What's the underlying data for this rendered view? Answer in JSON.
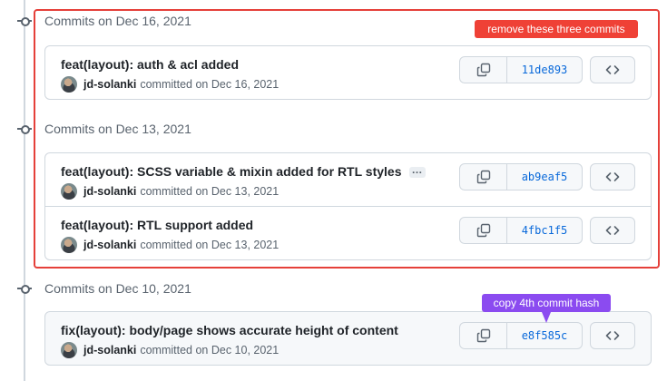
{
  "groups": [
    {
      "title": "Commits on Dec 16, 2021",
      "commits": [
        {
          "message": "feat(layout): auth & acl added",
          "author": "jd-solanki",
          "committed": "committed on Dec 16, 2021",
          "sha": "11de893"
        }
      ]
    },
    {
      "title": "Commits on Dec 13, 2021",
      "commits": [
        {
          "message": "feat(layout): SCSS variable & mixin added for RTL styles",
          "ellipsis": "…",
          "author": "jd-solanki",
          "committed": "committed on Dec 13, 2021",
          "sha": "ab9eaf5"
        },
        {
          "message": "feat(layout): RTL support added",
          "author": "jd-solanki",
          "committed": "committed on Dec 13, 2021",
          "sha": "4fbc1f5"
        }
      ]
    },
    {
      "title": "Commits on Dec 10, 2021",
      "commits": [
        {
          "message": "fix(layout): body/page shows accurate height of content",
          "author": "jd-solanki",
          "committed": "committed on Dec 10, 2021",
          "sha": "e8f585c"
        }
      ]
    }
  ],
  "annotations": {
    "remove_label": "remove these three commits",
    "copy_label": "copy 4th commit hash",
    "remove_color": "#ef4136",
    "copy_color": "#8b4bf0"
  },
  "icons": {
    "copy": "copy-icon",
    "browse": "code-icon",
    "commit_node": "git-commit-icon"
  }
}
